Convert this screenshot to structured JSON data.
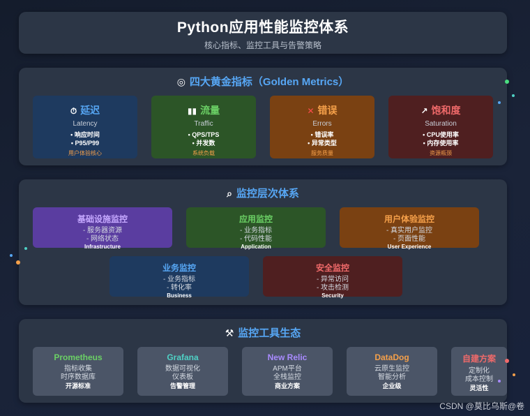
{
  "header": {
    "title": "Python应用性能监控体系",
    "subtitle": "核心指标、监控工具与告警策略"
  },
  "golden": {
    "icon": "target-icon",
    "title": "四大黄金指标（Golden Metrics）",
    "cards": [
      {
        "icon": "stopwatch-icon",
        "name": "延迟",
        "en": "Latency",
        "points": [
          "• 响应时间",
          "• P95/P99"
        ],
        "tag": "用户体验核心",
        "bg": "#1e3a5f",
        "color": "#57a7f5"
      },
      {
        "icon": "bar-chart-icon",
        "name": "流量",
        "en": "Traffic",
        "points": [
          "• QPS/TPS",
          "• 并发数"
        ],
        "tag": "系统负载",
        "bg": "#2c5527",
        "color": "#6bd065"
      },
      {
        "icon": "cross-mark-icon",
        "name": "错误",
        "en": "Errors",
        "points": [
          "• 错误率",
          "• 异常类型"
        ],
        "tag": "服务质量",
        "bg": "#7a4112",
        "color": "#f5a04a"
      },
      {
        "icon": "trend-chart-icon",
        "name": "饱和度",
        "en": "Saturation",
        "points": [
          "• CPU使用率",
          "• 内存使用率"
        ],
        "tag": "资源瓶颈",
        "bg": "#4f1f20",
        "color": "#f06a6a"
      }
    ]
  },
  "layers": {
    "icon": "magnifier-icon",
    "title": "监控层次体系",
    "cards": [
      {
        "name": "基础设施监控",
        "points": [
          "- 服务器资源",
          "- 网络状态"
        ],
        "en": "Infrastructure",
        "bg": "#5a3da0",
        "color": "#c5a8ff"
      },
      {
        "name": "应用监控",
        "points": [
          "- 业务指标",
          "- 代码性能"
        ],
        "en": "Application",
        "bg": "#2c5527",
        "color": "#6bd065"
      },
      {
        "name": "用户体验监控",
        "points": [
          "- 真实用户监控",
          "- 页面性能"
        ],
        "en": "User Experience",
        "bg": "#7a4112",
        "color": "#f5a04a"
      },
      {
        "name": "业务监控",
        "points": [
          "- 业务指标",
          "- 转化率"
        ],
        "en": "Business",
        "bg": "#1e3a5f",
        "color": "#57a7f5"
      },
      {
        "name": "安全监控",
        "points": [
          "- 异常访问",
          "- 攻击检测"
        ],
        "en": "Security",
        "bg": "#4f1f20",
        "color": "#f06a6a"
      }
    ]
  },
  "tools": {
    "icon": "hammer-wrench-icon",
    "title": "监控工具生态",
    "cards": [
      {
        "name": "Prometheus",
        "points": [
          "指标收集",
          "时序数据库"
        ],
        "tag": "开源标准",
        "color": "#6bd065"
      },
      {
        "name": "Grafana",
        "points": [
          "数据可视化",
          "仪表板"
        ],
        "tag": "告警管理",
        "color": "#4fd1c5"
      },
      {
        "name": "New Relic",
        "points": [
          "APM平台",
          "全栈监控"
        ],
        "tag": "商业方案",
        "color": "#a98bff"
      },
      {
        "name": "DataDog",
        "points": [
          "云原生监控",
          "智能分析"
        ],
        "tag": "企业级",
        "color": "#f5a04a"
      },
      {
        "name": "自建方案",
        "points": [
          "定制化",
          "成本控制"
        ],
        "tag": "灵活性",
        "color": "#f06a6a"
      }
    ]
  },
  "watermark": "CSDN @莫比乌斯@卷"
}
